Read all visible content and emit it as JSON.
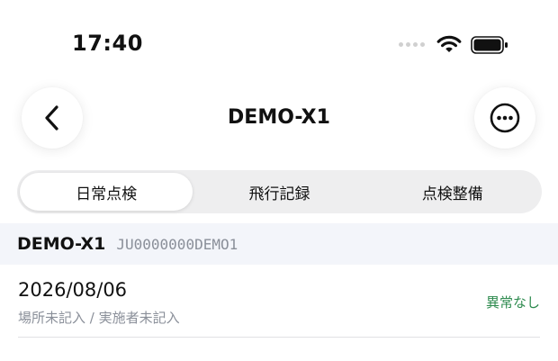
{
  "status_bar": {
    "time": "17:40"
  },
  "nav": {
    "title": "DEMO-X1",
    "back_icon": "chevron-left-icon",
    "more_icon": "ellipsis-circle-icon"
  },
  "tabs": [
    {
      "label": "日常点検",
      "active": true
    },
    {
      "label": "飛行記録",
      "active": false
    },
    {
      "label": "点検整備",
      "active": false
    }
  ],
  "section": {
    "name": "DEMO-X1",
    "registration_id": "JU0000000DEMO1"
  },
  "records": [
    {
      "date": "2026/08/06",
      "details": "場所未記入 / 実施者未記入",
      "status": "異常なし"
    }
  ],
  "colors": {
    "status_ok": "#2e8b4f",
    "section_bg": "#f3f5fa",
    "segment_bg": "#eeeeef"
  }
}
